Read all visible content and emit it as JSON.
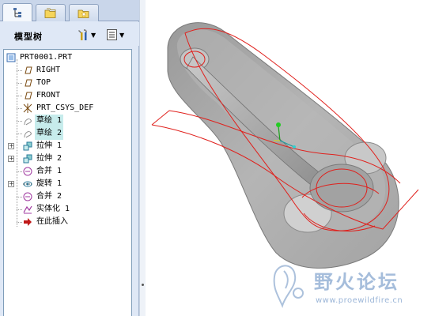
{
  "tabs": [
    {
      "name": "model-tree",
      "icon": "model-tree-icon",
      "active": true
    },
    {
      "name": "folder-browser",
      "icon": "folder-icon",
      "active": false
    },
    {
      "name": "favorites",
      "icon": "favorites-icon",
      "active": false
    }
  ],
  "tree_panel": {
    "title": "模型树",
    "settings_icon": "tools-icon",
    "show_icon": "show-list-icon"
  },
  "tree": [
    {
      "label": "PRT0001.PRT",
      "icon": "part-icon",
      "expandable": false,
      "selected": false
    },
    {
      "label": "RIGHT",
      "icon": "datum-plane-icon",
      "expandable": false,
      "selected": false
    },
    {
      "label": "TOP",
      "icon": "datum-plane-icon",
      "expandable": false,
      "selected": false
    },
    {
      "label": "FRONT",
      "icon": "datum-plane-icon",
      "expandable": false,
      "selected": false
    },
    {
      "label": "PRT_CSYS_DEF",
      "icon": "csys-icon",
      "expandable": false,
      "selected": false
    },
    {
      "label": "草绘 1",
      "icon": "sketch-icon",
      "expandable": false,
      "selected": true
    },
    {
      "label": "草绘 2",
      "icon": "sketch-icon",
      "expandable": false,
      "selected": true
    },
    {
      "label": "拉伸 1",
      "icon": "extrude-icon",
      "expandable": true,
      "selected": false
    },
    {
      "label": "拉伸 2",
      "icon": "extrude-icon",
      "expandable": true,
      "selected": false
    },
    {
      "label": "合并 1",
      "icon": "merge-icon",
      "expandable": false,
      "selected": false
    },
    {
      "label": "旋转 1",
      "icon": "revolve-icon",
      "expandable": true,
      "selected": false
    },
    {
      "label": "合并 2",
      "icon": "merge-icon",
      "expandable": false,
      "selected": false
    },
    {
      "label": "实体化 1",
      "icon": "solidify-icon",
      "expandable": false,
      "selected": false
    },
    {
      "label": "在此插入",
      "icon": "insert-here-arrow-icon",
      "expandable": false,
      "selected": false
    }
  ],
  "watermark": {
    "title": "野火论坛",
    "url": "www.proewildfire.cn"
  },
  "colors": {
    "panel_bg": "#dfe8f6",
    "selection": "#c7ecec",
    "model_gray": "#a9a9a9",
    "sketch_red": "#e0201c"
  }
}
